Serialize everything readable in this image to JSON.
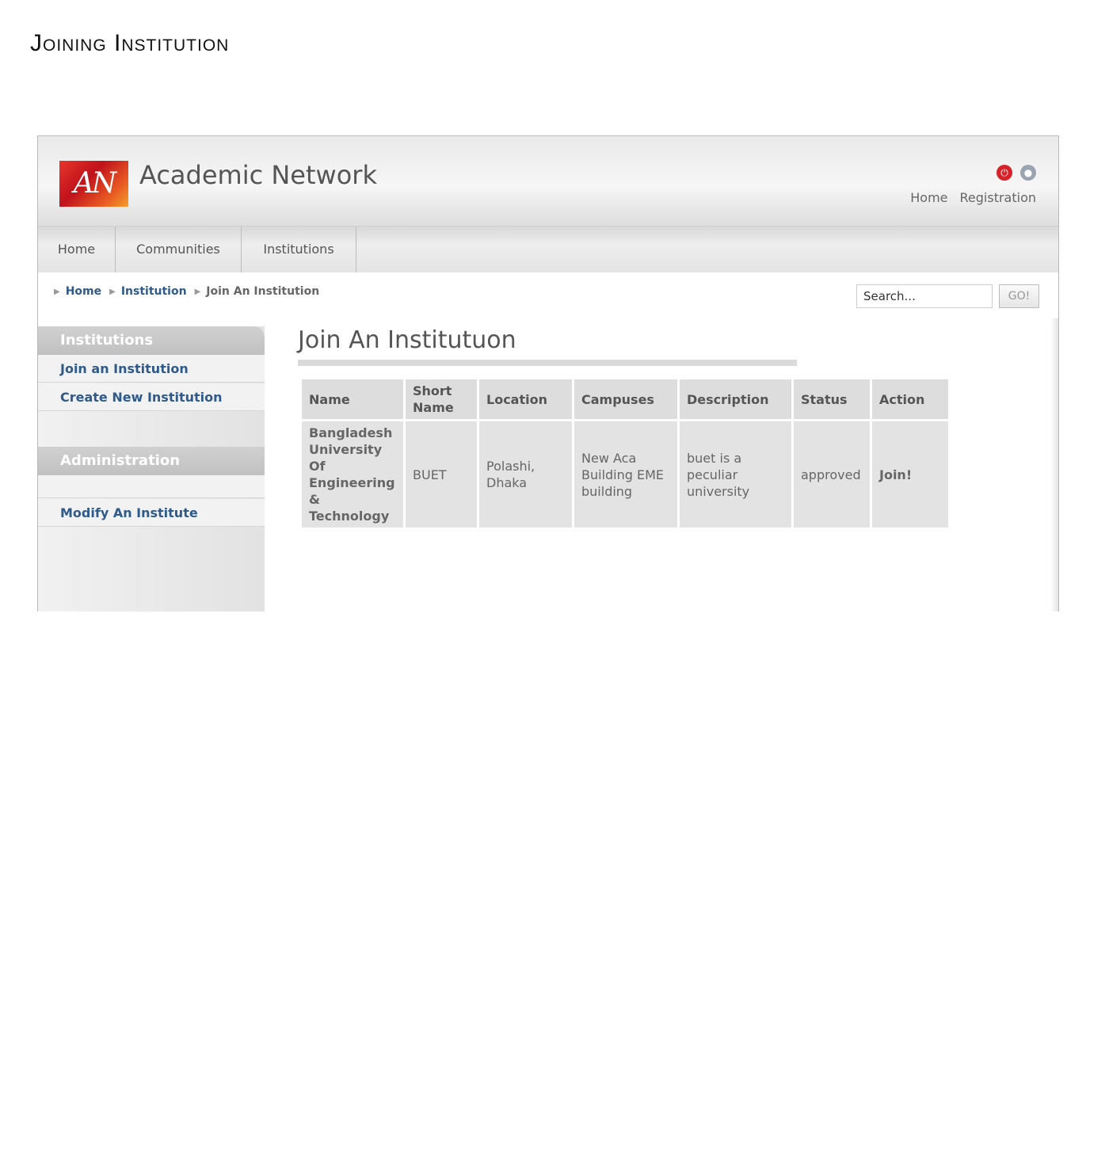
{
  "document": {
    "title": "Joining Institution"
  },
  "site": {
    "title": "Academic Network",
    "logo_text": "AN",
    "top_links": [
      "Home",
      "Registration"
    ]
  },
  "nav": {
    "items": [
      "Home",
      "Communities",
      "Institutions"
    ]
  },
  "breadcrumb": {
    "items": [
      "Home",
      "Institution"
    ],
    "current": "Join An Institution"
  },
  "search": {
    "placeholder": "Search...",
    "button_label": "GO!"
  },
  "sidebar": {
    "sections": [
      {
        "heading": "Institutions",
        "items": [
          "Join an Institution",
          "Create New Institution"
        ]
      },
      {
        "heading": "Administration",
        "items": [
          "Modify An Institute"
        ]
      }
    ]
  },
  "main": {
    "title": "Join An Institutuon",
    "table": {
      "headers": [
        "Name",
        "Short Name",
        "Location",
        "Campuses",
        "Description",
        "Status",
        "Action"
      ],
      "rows": [
        {
          "name": "Bangladesh University Of Engineering & Technology",
          "short_name": "BUET",
          "location": "Polashi, Dhaka",
          "campuses": "New Aca Building EME building",
          "description": "buet is a peculiar university",
          "status": "approved",
          "action": "Join!"
        }
      ]
    }
  },
  "colors": {
    "link": "#2f5a8a",
    "header_bg": "#e9e9e9",
    "sidebar_heading_bg": "#c8c8c8"
  }
}
